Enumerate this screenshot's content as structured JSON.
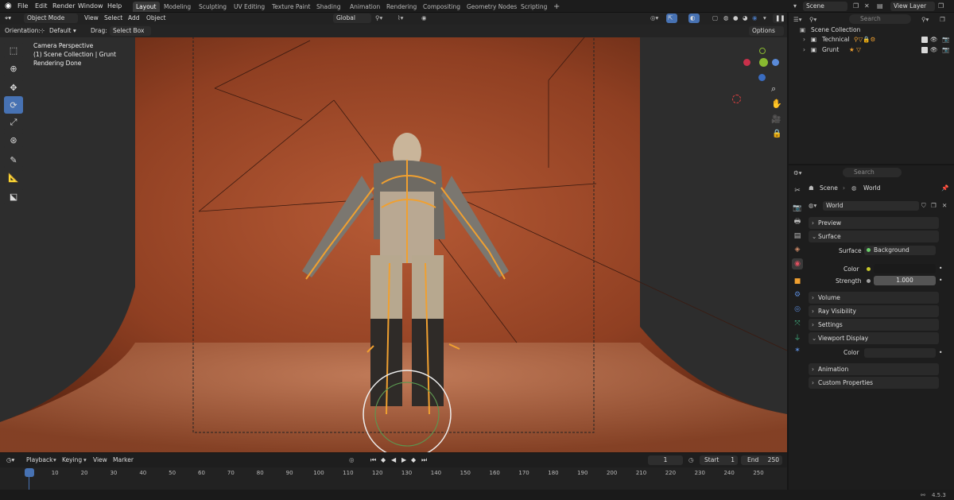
{
  "top_menu": {
    "items": [
      "File",
      "Edit",
      "Render",
      "Window",
      "Help"
    ]
  },
  "workspaces": [
    "Layout",
    "Modeling",
    "Sculpting",
    "UV Editing",
    "Texture Paint",
    "Shading",
    "Animation",
    "Rendering",
    "Compositing",
    "Geometry Nodes",
    "Scripting"
  ],
  "active_workspace": "Layout",
  "scene": {
    "label": "Scene"
  },
  "view_layer": {
    "label": "View Layer"
  },
  "viewport_header": {
    "mode": "Object Mode",
    "view": "View",
    "select": "Select",
    "add": "Add",
    "object": "Object",
    "transform": "Global"
  },
  "tool_header": {
    "orientation_label": "Orientation:",
    "orientation_value": "Default",
    "drag_label": "Drag:",
    "drag_value": "Select Box",
    "options": "Options"
  },
  "viewport_overlay": {
    "line1": "Camera Perspective",
    "line2": "(1) Scene Collection | Grunt",
    "line3": "Rendering Done"
  },
  "outliner": {
    "search_placeholder": "Search",
    "root": "Scene Collection",
    "items": [
      {
        "name": "Technical"
      },
      {
        "name": "Grunt"
      }
    ]
  },
  "properties": {
    "search_placeholder": "Search",
    "breadcrumb": {
      "scene": "Scene",
      "world": "World"
    },
    "world_name": "World",
    "panels": {
      "preview": "Preview",
      "surface": "Surface",
      "volume": "Volume",
      "ray_visibility": "Ray Visibility",
      "settings": "Settings",
      "viewport_display": "Viewport Display",
      "animation": "Animation",
      "custom_properties": "Custom Properties"
    },
    "surface_label": "Surface",
    "surface_value": "Background",
    "color_label": "Color",
    "strength_label": "Strength",
    "strength_value": "1.000",
    "vd_color_label": "Color"
  },
  "timeline": {
    "playback": "Playback",
    "keying": "Keying",
    "view": "View",
    "marker": "Marker",
    "current_frame": "1",
    "start_label": "Start",
    "start_value": "1",
    "end_label": "End",
    "end_value": "250",
    "ticks": [
      "1",
      "10",
      "20",
      "30",
      "40",
      "50",
      "60",
      "70",
      "80",
      "90",
      "100",
      "110",
      "120",
      "130",
      "140",
      "150",
      "160",
      "170",
      "180",
      "190",
      "200",
      "210",
      "220",
      "230",
      "240",
      "250"
    ]
  },
  "status": {
    "version": "4.5.3"
  },
  "colors": {
    "accent": "#4772b3",
    "backdrop": "#b55d37",
    "bone": "#f0a030",
    "timeline_marker": "#4772b3"
  }
}
